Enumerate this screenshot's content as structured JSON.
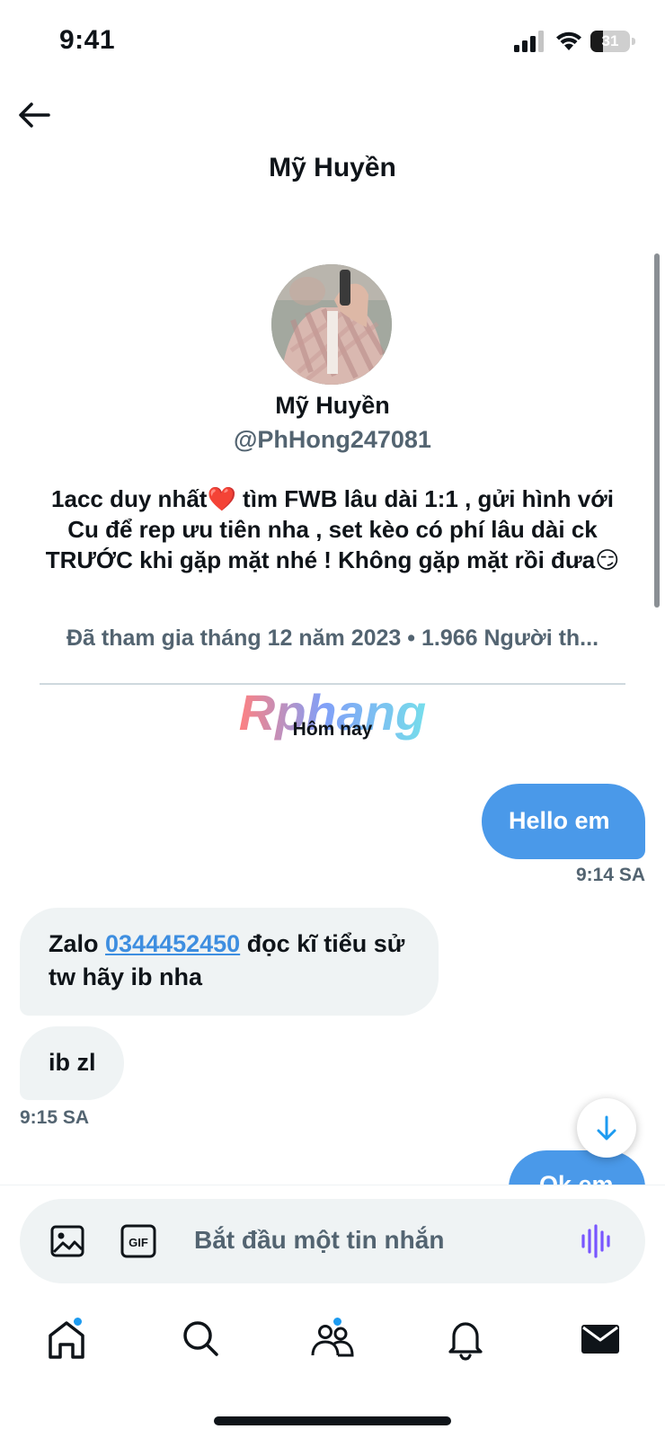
{
  "status_bar": {
    "time": "9:41",
    "battery_level": "31",
    "battery_fraction": 0.31
  },
  "header": {
    "title": "Mỹ Huyền",
    "back_icon": "arrow-left-icon"
  },
  "profile": {
    "name": "Mỹ Huyền",
    "handle": "@PhHong247081",
    "bio_part1": "1acc duy nhất",
    "bio_emoji1": "❤️",
    "bio_part2": " tìm FWB lâu dài 1:1 , gửi hình với Cu để rep ưu tiên nha , set kèo có phí lâu dài ck TRƯỚC khi gặp mặt nhé ! Không gặp mặt rồi đưa",
    "bio_emoji2": "😏",
    "joined": "Đã tham gia tháng 12 năm 2023 • 1.966 Người th..."
  },
  "watermark": "Rphang",
  "conversation": {
    "date_separator": "Hôm nay",
    "messages": [
      {
        "direction": "out",
        "text": "Hello em",
        "time": "9:14 SA"
      },
      {
        "direction": "in",
        "text_before": "Zalo ",
        "link": "0344452450",
        "text_after": " đọc kĩ tiểu sử tw hãy ib nha"
      },
      {
        "direction": "in",
        "text": "ib zl",
        "time": "9:15 SA"
      },
      {
        "direction": "out",
        "text": "Ok em"
      }
    ]
  },
  "composer": {
    "placeholder": "Bắt đầu một tin nhắn",
    "value": "",
    "gif_label": "GIF",
    "icons": [
      "image-icon",
      "gif-icon",
      "voice-icon"
    ]
  },
  "tab_bar": {
    "tabs": [
      {
        "name": "home",
        "icon": "home-icon",
        "badge": true
      },
      {
        "name": "search",
        "icon": "search-icon",
        "badge": false
      },
      {
        "name": "communities",
        "icon": "communities-icon",
        "badge": true
      },
      {
        "name": "notifications",
        "icon": "bell-icon",
        "badge": false
      },
      {
        "name": "messages",
        "icon": "mail-icon",
        "badge": false,
        "active": true
      }
    ]
  },
  "colors": {
    "accent": "#1d9bf0",
    "outgoing_bubble": "#4a99e9",
    "incoming_bubble": "#eff3f4",
    "secondary_text": "#536471",
    "voice_icon": "#7856ff"
  }
}
